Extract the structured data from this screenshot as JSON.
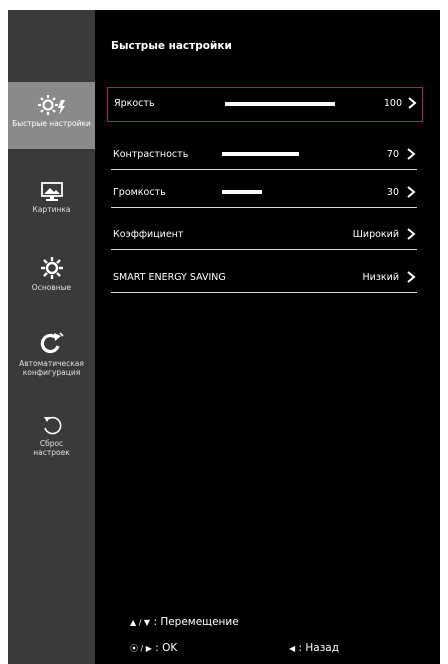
{
  "sidebar": {
    "items": [
      {
        "label": "Быстрые настройки",
        "icon": "quick-settings-icon",
        "active": true
      },
      {
        "label": "Картинка",
        "icon": "picture-icon",
        "active": false
      },
      {
        "label": "Основные",
        "icon": "gear-icon",
        "active": false
      },
      {
        "label": "Автоматическая конфигурация",
        "icon": "auto-config-icon",
        "active": false
      },
      {
        "label": "Сброс настроек",
        "icon": "reset-icon",
        "active": false
      }
    ]
  },
  "main": {
    "title": "Быстрые настройки",
    "rows": [
      {
        "label": "Яркость",
        "value": "100",
        "level": 100,
        "selected": true
      },
      {
        "label": "Контрастность",
        "value": "70",
        "level": 70,
        "selected": false
      },
      {
        "label": "Громкость",
        "value": "30",
        "level": 30,
        "selected": false
      },
      {
        "label": "Коэффициент",
        "value": "Широкий",
        "selected": false
      },
      {
        "label": "SMART ENERGY SAVING",
        "value": "Низкий",
        "selected": false
      }
    ]
  },
  "help": {
    "move_symbols": "▲ / ▼",
    "move_text": ": Перемещение",
    "ok_symbols": "⦿ / ▶",
    "ok_text": ": OK",
    "back_symbol": "◀",
    "back_text": ": Назад"
  },
  "colors": {
    "selection_border": "#c2185b",
    "sidebar_bg": "#3a3a3a",
    "sidebar_active_bg": "#8a8a8a"
  }
}
